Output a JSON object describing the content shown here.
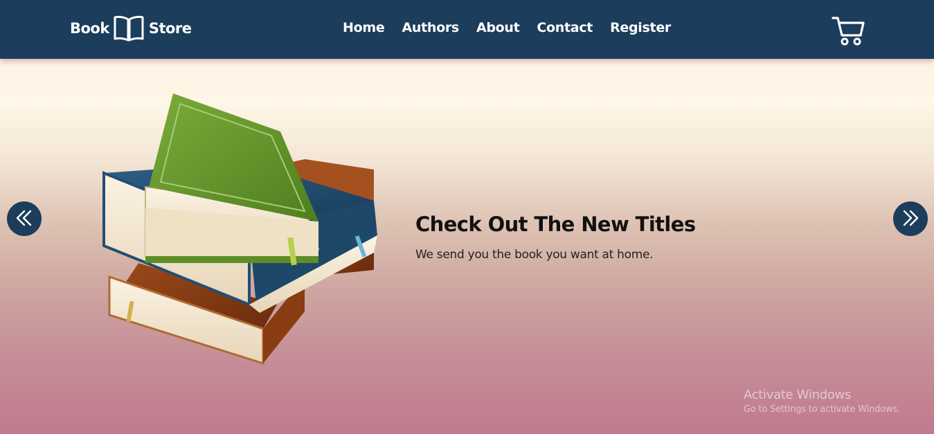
{
  "brand": {
    "left_text": "Book",
    "right_text": "Store",
    "icon": "open-book-icon"
  },
  "nav": {
    "items": [
      {
        "label": "Home"
      },
      {
        "label": "Authors"
      },
      {
        "label": "About"
      },
      {
        "label": "Contact"
      },
      {
        "label": "Register"
      }
    ],
    "cart_icon": "shopping-cart-icon"
  },
  "hero": {
    "title": "Check Out The New Titles",
    "subtitle": "We send you the book you want at home.",
    "image": "stack-of-books-illustration",
    "prev_icon": "double-chevron-left-icon",
    "next_icon": "double-chevron-right-icon"
  },
  "watermark": {
    "title": "Activate Windows",
    "subtitle": "Go to Settings to activate Windows."
  },
  "colors": {
    "navbar": "#1c3d5c",
    "nav_text": "#ffffff",
    "slider_button": "#1c3d5c",
    "hero_gradient_top": "#fef6e6",
    "hero_gradient_bottom": "#c07a8d"
  }
}
